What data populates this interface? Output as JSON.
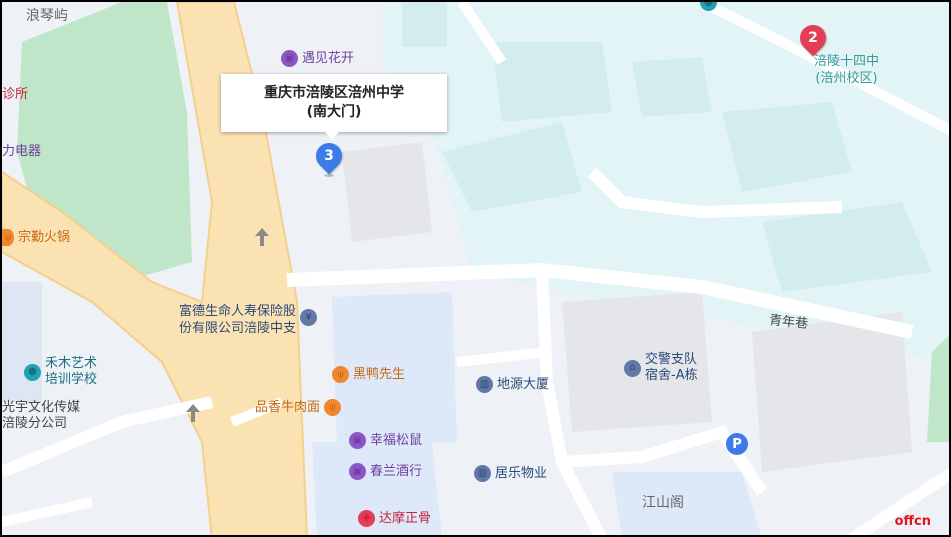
{
  "map": {
    "colors": {
      "land": "#eef1f6",
      "campus": "#e2f4f6",
      "building": "#d3edee",
      "park": "#bfe6c8",
      "highway": "#fbe2b3",
      "road": "#ffffff",
      "marker_blue": "#3d7ce8",
      "marker_red": "#e53d55"
    }
  },
  "callout": {
    "line1": "重庆市涪陵区涪州中学",
    "line2": "(南大门)"
  },
  "markers": [
    {
      "number": "3",
      "color": "blue"
    },
    {
      "number": "2",
      "color": "red"
    }
  ],
  "school_label": {
    "line1": "涪陵十四中",
    "line2": "(涪州校区)"
  },
  "area_labels": {
    "langqinyu": "浪琴屿",
    "clinic": "诊所",
    "appliance": "力电器",
    "qingnian_lane": "青年巷",
    "jiangshange": "江山阁",
    "guangyu_line1": "光宇文化传媒",
    "guangyu_line2": "涪陵分公司"
  },
  "pois": [
    {
      "name": "遇见花开",
      "category": "shop",
      "icon": "shopping-bag-icon"
    },
    {
      "name": "宗勤火锅",
      "category": "food",
      "icon": "fork-knife-icon"
    },
    {
      "name_line1": "富德生命人寿保险股",
      "name_line2": "份有限公司涪陵中支",
      "category": "finance",
      "icon": "yen-icon"
    },
    {
      "name_line1": "禾木艺术",
      "name_line2": "培训学校",
      "category": "education",
      "icon": "pin-icon"
    },
    {
      "name": "黑鸭先生",
      "category": "food",
      "icon": "fork-knife-icon"
    },
    {
      "name": "品香牛肉面",
      "category": "food",
      "icon": "fork-knife-icon"
    },
    {
      "name": "幸福松鼠",
      "category": "shop",
      "icon": "shopping-bag-icon"
    },
    {
      "name": "春兰酒行",
      "category": "shop",
      "icon": "shopping-bag-icon"
    },
    {
      "name": "达摩正骨",
      "category": "medical",
      "icon": "medical-cross-icon"
    },
    {
      "name": "地源大厦",
      "category": "building",
      "icon": "building-icon"
    },
    {
      "name": "居乐物业",
      "category": "building",
      "icon": "building-icon"
    },
    {
      "name_line1": "交警支队",
      "name_line2": "宿舍-A栋",
      "category": "residence",
      "icon": "house-icon"
    }
  ],
  "parking": {
    "label": "P"
  },
  "watermark": "offcn"
}
